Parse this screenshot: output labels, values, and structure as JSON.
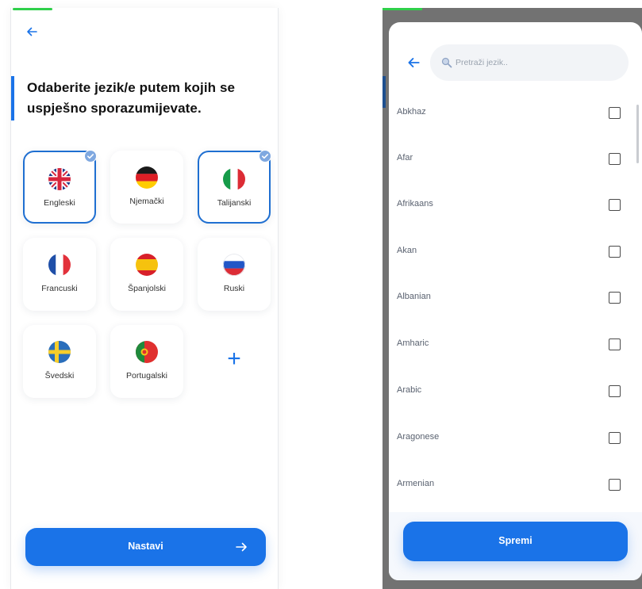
{
  "onboarding": {
    "heading": "Odaberite jezik/e putem kojih se uspješno sporazumijevate.",
    "languages": [
      {
        "label": "Engleski",
        "flag": "uk-flag-icon",
        "selected": true
      },
      {
        "label": "Njemački",
        "flag": "germany-flag-icon",
        "selected": false
      },
      {
        "label": "Talijanski",
        "flag": "italy-flag-icon",
        "selected": true
      },
      {
        "label": "Francuski",
        "flag": "france-flag-icon",
        "selected": false
      },
      {
        "label": "Španjolski",
        "flag": "spain-flag-icon",
        "selected": false
      },
      {
        "label": "Ruski",
        "flag": "russia-flag-icon",
        "selected": false
      },
      {
        "label": "Švedski",
        "flag": "sweden-flag-icon",
        "selected": false
      },
      {
        "label": "Portugalski",
        "flag": "portugal-flag-icon",
        "selected": false
      }
    ],
    "add_label": "+",
    "continue_label": "Nastavi"
  },
  "picker": {
    "search_placeholder": "Pretraži jezik..",
    "search_value": "",
    "items": [
      {
        "label": "Abkhaz",
        "checked": false
      },
      {
        "label": "Afar",
        "checked": false
      },
      {
        "label": "Afrikaans",
        "checked": false
      },
      {
        "label": "Akan",
        "checked": false
      },
      {
        "label": "Albanian",
        "checked": false
      },
      {
        "label": "Amharic",
        "checked": false
      },
      {
        "label": "Arabic",
        "checked": false
      },
      {
        "label": "Aragonese",
        "checked": false
      },
      {
        "label": "Armenian",
        "checked": false
      }
    ],
    "save_label": "Spremi"
  },
  "colors": {
    "accent": "#1a73e8",
    "progress": "#2fcf4a",
    "tile_border": "#1f6fd1",
    "overlay": "#727272"
  }
}
